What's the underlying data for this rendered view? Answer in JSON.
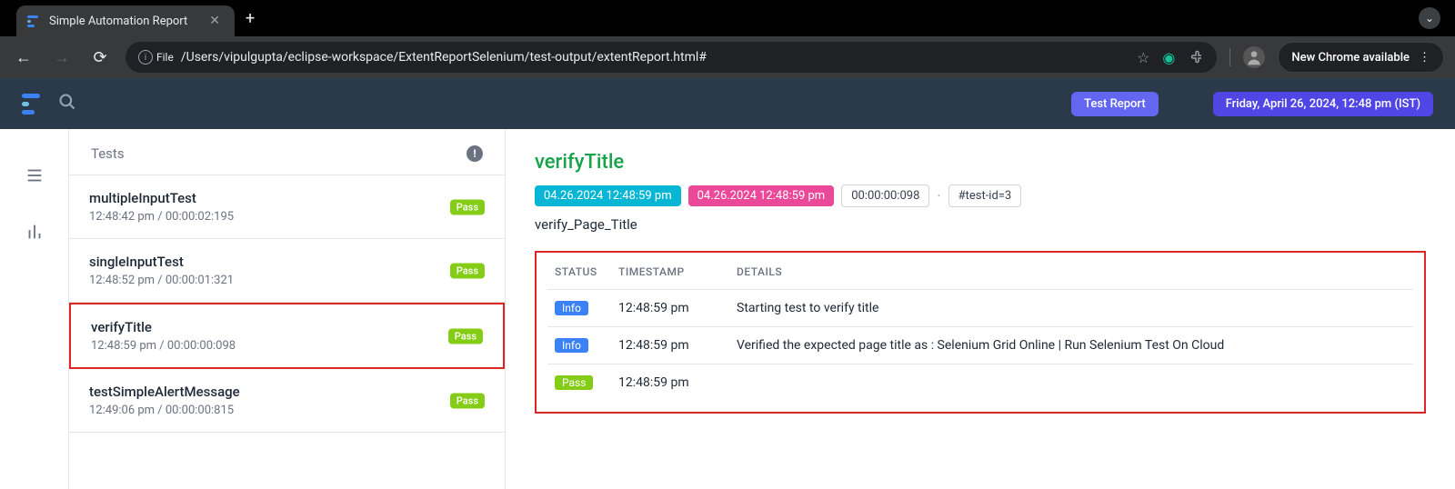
{
  "browser": {
    "tab_title": "Simple Automation Report",
    "file_label": "File",
    "url": "/Users/vipulgupta/eclipse-workspace/ExtentReportSelenium/test-output/extentReport.html#",
    "new_chrome": "New Chrome available"
  },
  "header": {
    "test_report": "Test Report",
    "timestamp": "Friday, April 26, 2024, 12:48 pm (IST)"
  },
  "tests_panel": {
    "heading": "Tests",
    "items": [
      {
        "name": "multipleInputTest",
        "meta": "12:48:42 pm / 00:00:02:195",
        "status": "Pass"
      },
      {
        "name": "singleInputTest",
        "meta": "12:48:52 pm / 00:00:01:321",
        "status": "Pass"
      },
      {
        "name": "verifyTitle",
        "meta": "12:48:59 pm / 00:00:00:098",
        "status": "Pass"
      },
      {
        "name": "testSimpleAlertMessage",
        "meta": "12:49:06 pm / 00:00:00:815",
        "status": "Pass"
      }
    ]
  },
  "detail": {
    "title": "verifyTitle",
    "chips": {
      "start": "04.26.2024 12:48:59 pm",
      "end": "04.26.2024 12:48:59 pm",
      "duration": "00:00:00:098",
      "test_id": "#test-id=3"
    },
    "subtitle": "verify_Page_Title",
    "table": {
      "headers": {
        "status": "STATUS",
        "timestamp": "TIMESTAMP",
        "details": "DETAILS"
      },
      "rows": [
        {
          "status": "Info",
          "status_class": "info",
          "time": "12:48:59 pm",
          "details": "Starting test to verify title"
        },
        {
          "status": "Info",
          "status_class": "info",
          "time": "12:48:59 pm",
          "details": "Verified the expected page title as : Selenium Grid Online | Run Selenium Test On Cloud"
        },
        {
          "status": "Pass",
          "status_class": "pass",
          "time": "12:48:59 pm",
          "details": ""
        }
      ]
    }
  }
}
